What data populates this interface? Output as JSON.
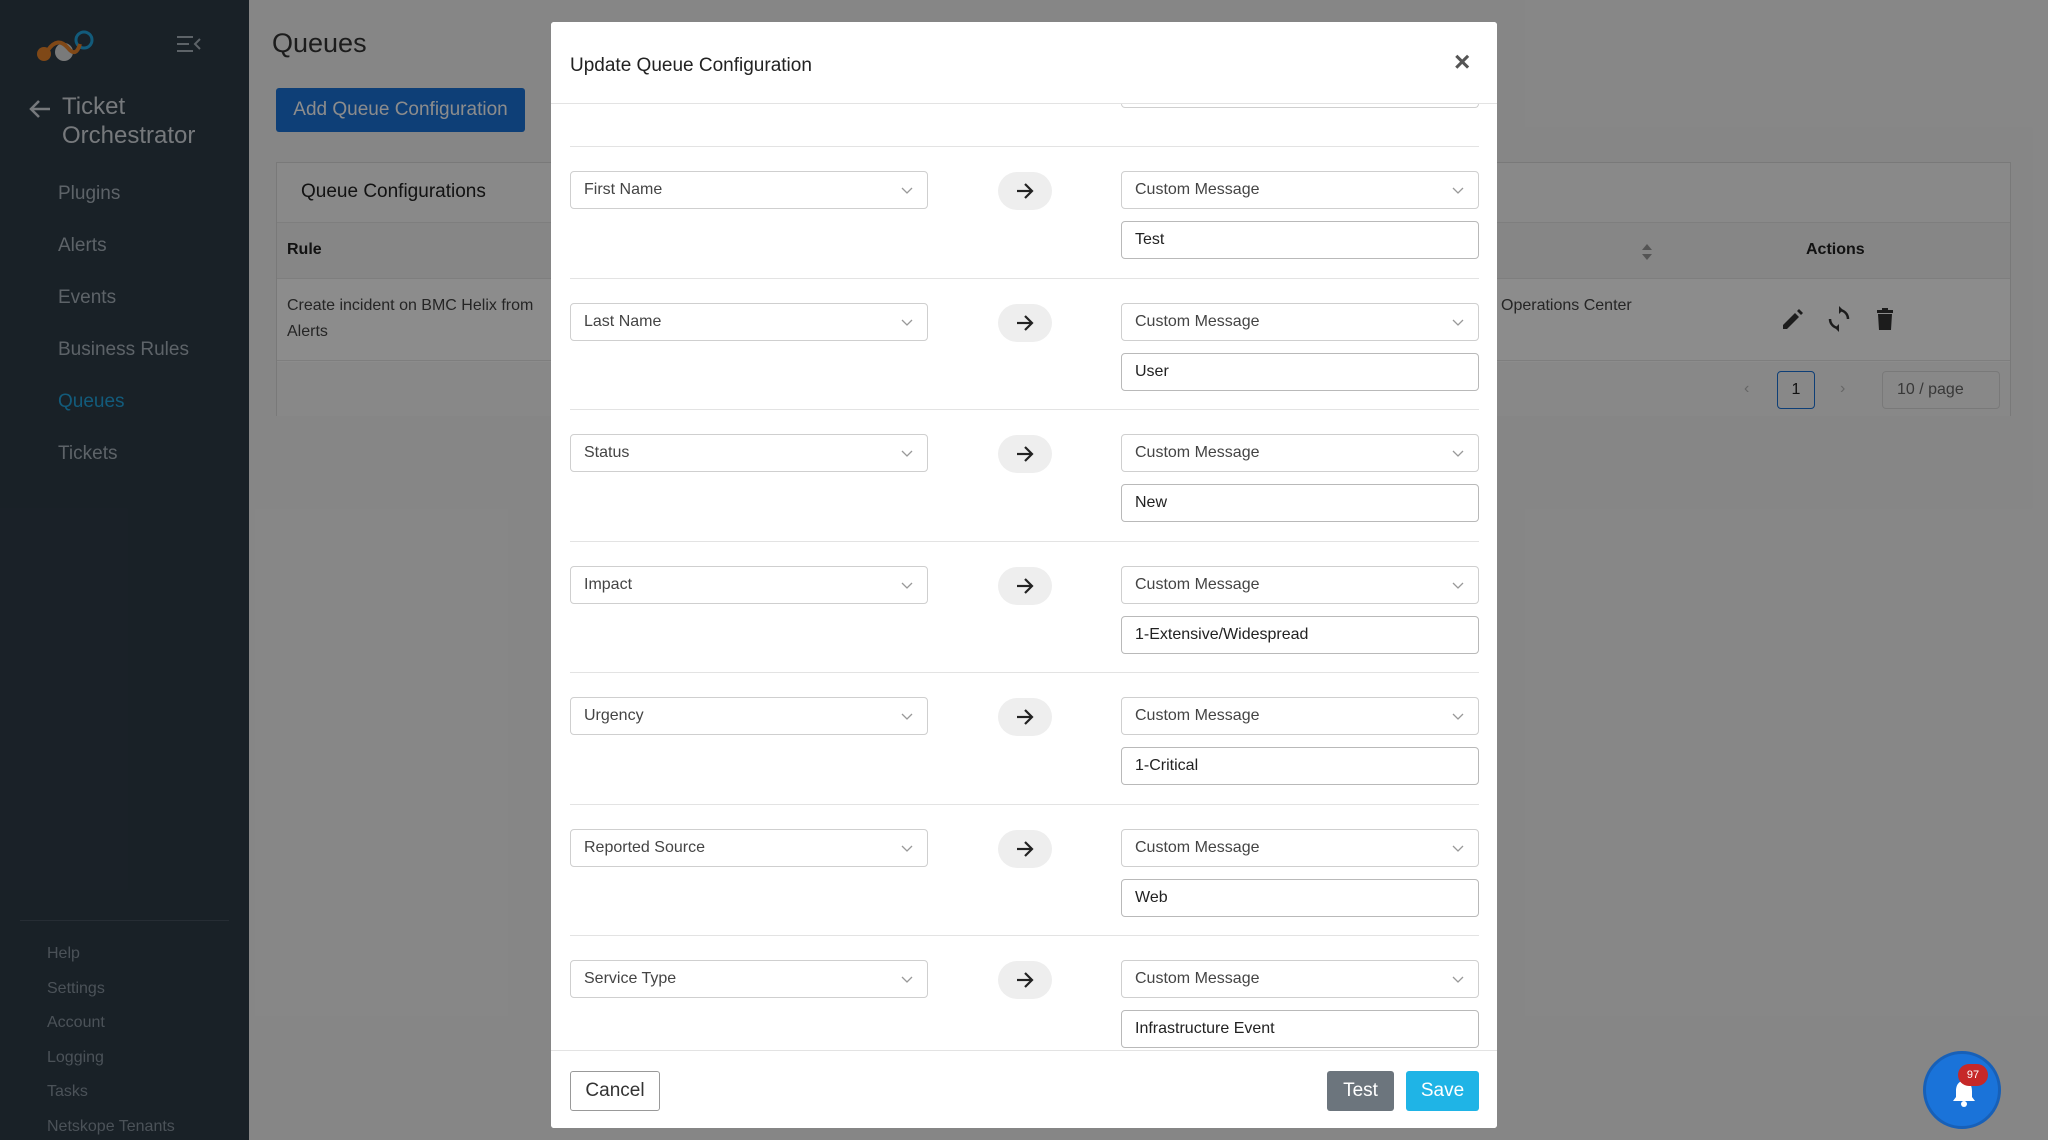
{
  "sidebar": {
    "app_title": "Ticket Orchestrator",
    "nav": [
      "Plugins",
      "Alerts",
      "Events",
      "Business Rules",
      "Queues",
      "Tickets"
    ],
    "active": "Queues",
    "bottom": [
      "Help",
      "Settings",
      "Account",
      "Logging",
      "Tasks",
      "Netskope Tenants"
    ]
  },
  "main": {
    "page_title": "Queues",
    "add_button": "Add Queue Configuration",
    "card_title": "Queue Configurations",
    "columns": {
      "rule": "Rule",
      "actions": "Actions"
    },
    "row": {
      "rule": "Create incident on BMC Helix from Alerts",
      "destination_partial": "Operations Center"
    },
    "pagination": {
      "page": "1",
      "page_size": "10 / page"
    }
  },
  "modal": {
    "title": "Update Queue Configuration",
    "close": "×",
    "mappings": [
      {
        "source": "First Name",
        "target_type": "Custom Message",
        "value": "Test"
      },
      {
        "source": "Last Name",
        "target_type": "Custom Message",
        "value": "User"
      },
      {
        "source": "Status",
        "target_type": "Custom Message",
        "value": "New"
      },
      {
        "source": "Impact",
        "target_type": "Custom Message",
        "value": "1-Extensive/Widespread"
      },
      {
        "source": "Urgency",
        "target_type": "Custom Message",
        "value": "1-Critical"
      },
      {
        "source": "Reported Source",
        "target_type": "Custom Message",
        "value": "Web"
      },
      {
        "source": "Service Type",
        "target_type": "Custom Message",
        "value": "Infrastructure Event"
      }
    ],
    "buttons": {
      "cancel": "Cancel",
      "test": "Test",
      "save": "Save"
    }
  },
  "notifications": {
    "count": "97"
  },
  "colors": {
    "sidebar": "#2f3c48",
    "active_nav": "#22a7e0",
    "primary": "#1a73d9",
    "save": "#1fb4e6",
    "badge": "#c62828"
  }
}
